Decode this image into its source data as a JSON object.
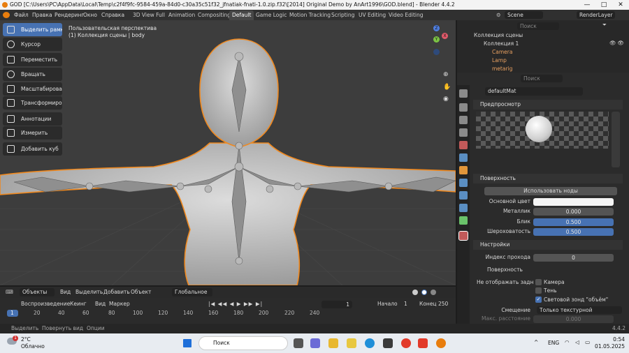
{
  "window": {
    "title": "GOD [C:\\Users\\PC\\AppData\\Local\\Temp\\c2f4f9fc-9584-459a-84d0-c30a35c51f32_jfnatiak-fnati-1.0.zip.f32\\[2014] Original Demo by AnArt1996\\GOD.blend] - Blender 4.4.2",
    "minimize": "—",
    "maximize": "□",
    "close": "✕"
  },
  "menu": {
    "file": "Файл",
    "edit": "Правка",
    "render": "Рендеринг",
    "window": "Окно",
    "help": "Справка"
  },
  "workspaces": [
    "3D View Full",
    "Animation",
    "Compositing",
    "Default",
    "Game Logic",
    "Motion Tracking",
    "Scripting",
    "UV Editing",
    "Video Editing"
  ],
  "scene": "Scene",
  "view_layer": "RenderLayer",
  "tools": [
    "Выделить рамкой",
    "Курсор",
    "Переместить",
    "Вращать",
    "Масштабировать",
    "Трансформиро...",
    "Аннотации",
    "Измерить",
    "Добавить куб"
  ],
  "viewport": {
    "perspective": "Пользовательская перспектива",
    "collection": "(1) Коллекция сцены | body"
  },
  "gizmo": {
    "z": "Z",
    "y": "Y",
    "x": "X"
  },
  "viewport_header": {
    "mode": "Объекты",
    "view": "Вид",
    "select": "Выделить",
    "add": "Добавить",
    "object": "Объект",
    "transform": "Глобальное"
  },
  "timeline": {
    "playback": "Воспроизведение",
    "keying": "Кеинг",
    "view": "Вид",
    "marker": "Маркер",
    "current_frame": "1",
    "start_label": "Начало",
    "start": "1",
    "end_label": "Конец",
    "end": "250",
    "ticks": [
      "1",
      "20",
      "40",
      "60",
      "80",
      "100",
      "120",
      "140",
      "160",
      "180",
      "200",
      "220",
      "240"
    ]
  },
  "status": {
    "select": "Выделить",
    "rotate": "Повернуть вид",
    "options": "Опции",
    "version": "4.4.2"
  },
  "outliner": {
    "search_placeholder": "Поиск",
    "root": "Коллекция сцены",
    "collection": "Коллекция 1",
    "items": [
      "Camera",
      "Lamp",
      "metarig"
    ]
  },
  "properties": {
    "search_placeholder": "Поиск",
    "material": "defaultMat",
    "preview": "Предпросмотр",
    "surface": "Поверхность",
    "use_nodes": "Использовать ноды",
    "base_color_label": "Основной цвет",
    "metallic_label": "Металлик",
    "metallic": "0.000",
    "specular_label": "Блик",
    "specular": "0.500",
    "roughness_label": "Шероховатость",
    "roughness": "0.500",
    "settings": "Настройки",
    "pass_index_label": "Индекс прохода",
    "pass_index": "0",
    "surface_sub": "Поверхность",
    "hide_label": "Не отображать задние ...",
    "camera": "Камера",
    "shadow": "Тень",
    "volume_probe": "Световой зонд \"объём\"",
    "offset_label": "Смещение",
    "offset_value": "Только текстурной",
    "max_dist_label": "Макс. расстояние",
    "max_dist": "0.000"
  },
  "taskbar": {
    "temp": "2°C",
    "weather": "Облачно",
    "search": "Поиск",
    "lang": "ENG",
    "time": "0:54",
    "date": "01.05.2025",
    "badge": "1"
  },
  "colors": {
    "accent": "#4772b3",
    "orange": "#e87d0d",
    "selection_outline": "#f0891f"
  }
}
